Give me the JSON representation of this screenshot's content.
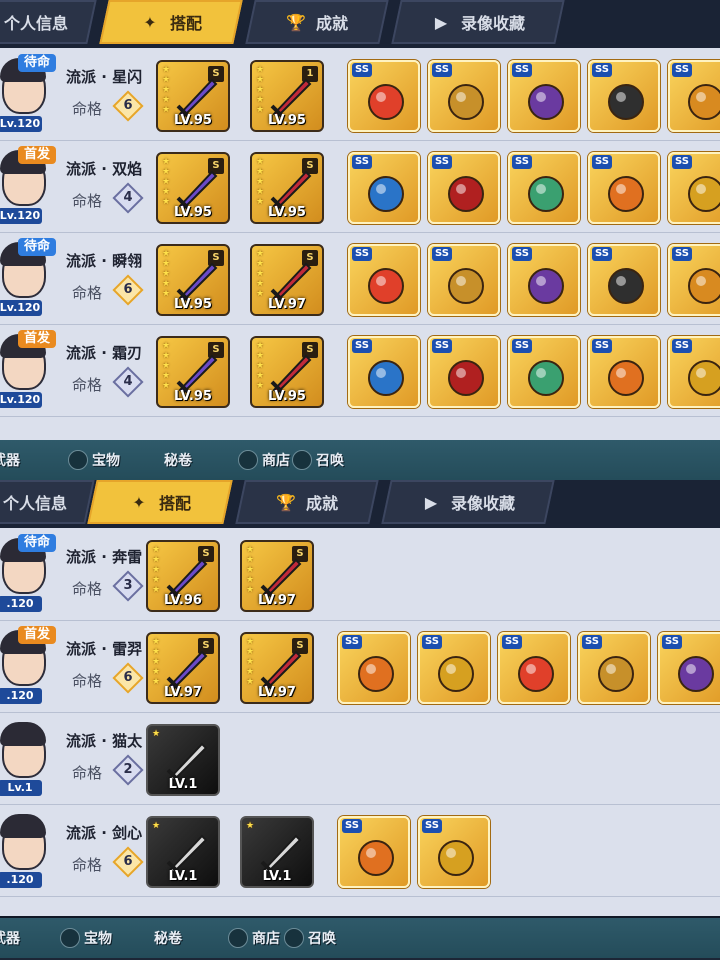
{
  "colors": {
    "active_tab": "#f2c23c",
    "tab_bg": "#2a3347",
    "list_bg": "#dbe0ec",
    "level_badge": "#1e4a9a",
    "standby_status": "#2f7de0",
    "starter_status": "#e98a1f"
  },
  "tabs": [
    {
      "label": "个人信息",
      "icon": ""
    },
    {
      "label": "搭配",
      "icon": "shuriken-icon"
    },
    {
      "label": "成就",
      "icon": "trophy-icon"
    },
    {
      "label": "录像收藏",
      "icon": "play-icon"
    }
  ],
  "fate_label": "命格",
  "bottom_nav": [
    {
      "label": "武器",
      "icon": "weapon-icon"
    },
    {
      "label": "宝物",
      "icon": "treasure-icon"
    },
    {
      "label": "秘卷",
      "icon": "scroll-icon"
    },
    {
      "label": "商店",
      "icon": "shop-icon"
    },
    {
      "label": "召唤",
      "icon": "summon-icon"
    }
  ],
  "panels": [
    {
      "rows": [
        {
          "status": "待命",
          "level": "Lv.120",
          "school": "流派 · 星闪",
          "fate": "6",
          "weapons": [
            {
              "rank": "S",
              "level": "LV.95",
              "stars": 5
            },
            {
              "rank": "1",
              "level": "LV.95",
              "stars": 5
            }
          ],
          "treasures": [
            {
              "grade": "SS"
            },
            {
              "grade": "SS"
            },
            {
              "grade": "SS"
            },
            {
              "grade": "SS"
            },
            {
              "grade": "SS"
            }
          ]
        },
        {
          "status": "首发",
          "level": "Lv.120",
          "school": "流派 · 双焰",
          "fate": "4",
          "weapons": [
            {
              "rank": "S",
              "level": "LV.95",
              "stars": 5
            },
            {
              "rank": "S",
              "level": "LV.95",
              "stars": 5
            }
          ],
          "treasures": [
            {
              "grade": "SS"
            },
            {
              "grade": "SS"
            },
            {
              "grade": "SS"
            },
            {
              "grade": "SS"
            },
            {
              "grade": "SS"
            }
          ]
        },
        {
          "status": "待命",
          "level": "Lv.120",
          "school": "流派 · 瞬翎",
          "fate": "6",
          "weapons": [
            {
              "rank": "S",
              "level": "LV.95",
              "stars": 5
            },
            {
              "rank": "S",
              "level": "LV.97",
              "stars": 5
            }
          ],
          "treasures": [
            {
              "grade": "SS"
            },
            {
              "grade": "SS"
            },
            {
              "grade": "SS"
            },
            {
              "grade": "SS"
            },
            {
              "grade": "SS"
            }
          ]
        },
        {
          "status": "首发",
          "level": "Lv.120",
          "school": "流派 · 霜刃",
          "fate": "4",
          "weapons": [
            {
              "rank": "S",
              "level": "LV.95",
              "stars": 5
            },
            {
              "rank": "S",
              "level": "LV.95",
              "stars": 5
            }
          ],
          "treasures": [
            {
              "grade": "SS"
            },
            {
              "grade": "SS"
            },
            {
              "grade": "SS"
            },
            {
              "grade": "SS"
            },
            {
              "grade": "SS"
            }
          ]
        }
      ]
    },
    {
      "rows": [
        {
          "status": "待命",
          "level": ".120",
          "school": "流派 · 奔雷",
          "fate": "3",
          "weapons": [
            {
              "rank": "S",
              "level": "LV.96",
              "stars": 5
            },
            {
              "rank": "S",
              "level": "LV.97",
              "stars": 5
            }
          ],
          "treasures": []
        },
        {
          "status": "首发",
          "level": ".120",
          "school": "流派 · 雷羿",
          "fate": "6",
          "weapons": [
            {
              "rank": "S",
              "level": "LV.97",
              "stars": 5
            },
            {
              "rank": "S",
              "level": "LV.97",
              "stars": 5
            }
          ],
          "treasures": [
            {
              "grade": "SS"
            },
            {
              "grade": "SS"
            },
            {
              "grade": "SS"
            },
            {
              "grade": "SS"
            },
            {
              "grade": "SS"
            }
          ]
        },
        {
          "status": "",
          "level": "Lv.1",
          "school": "流派 · 猫太",
          "fate": "2",
          "weapons": [
            {
              "rank": "",
              "level": "LV.1",
              "stars": 1
            }
          ],
          "treasures": []
        },
        {
          "status": "",
          "level": ".120",
          "school": "流派 · 剑心",
          "fate": "6",
          "weapons": [
            {
              "rank": "",
              "level": "LV.1",
              "stars": 1
            },
            {
              "rank": "",
              "level": "LV.1",
              "stars": 1
            }
          ],
          "treasures": [
            {
              "grade": "SS"
            },
            {
              "grade": "SS"
            }
          ]
        }
      ]
    }
  ]
}
